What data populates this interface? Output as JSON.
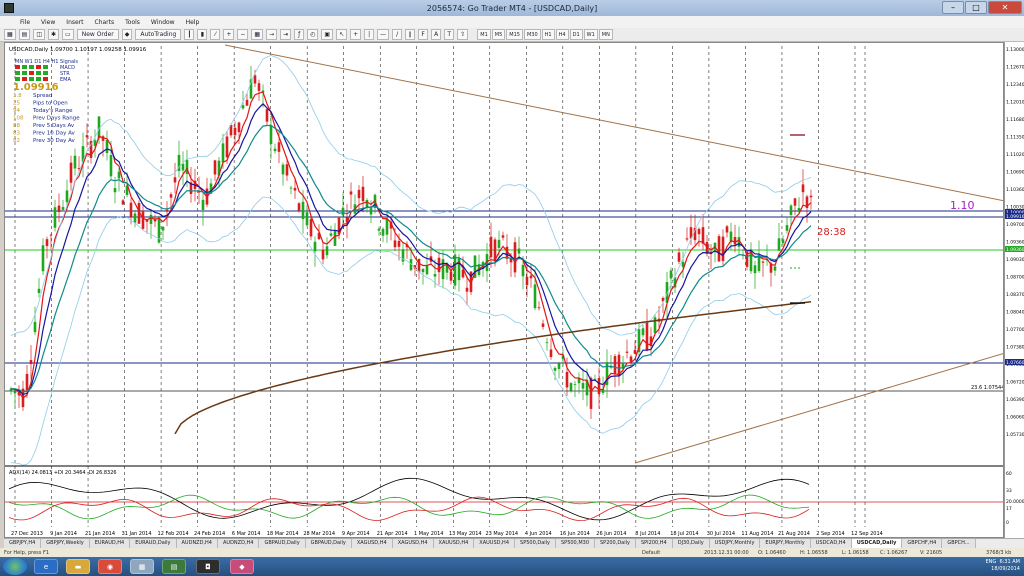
{
  "window": {
    "title": "2056574: Go Trader MT4 - [USDCAD,Daily]"
  },
  "menu": [
    "File",
    "View",
    "Insert",
    "Charts",
    "Tools",
    "Window",
    "Help"
  ],
  "toolbar": {
    "new_order": "New Order",
    "autotrading": "AutoTrading",
    "timeframes": [
      "M1",
      "M5",
      "M15",
      "M30",
      "H1",
      "H4",
      "D1",
      "W1",
      "MN"
    ]
  },
  "chart": {
    "header": "USDCAD,Daily  1.09700 1.10197 1.09258 1.09916",
    "indicator_rows": [
      "MN  W1  D1  H4  H1  Signals",
      "MACD",
      "STR",
      "EMA"
    ],
    "current_price": "1.09916",
    "info_rows": [
      {
        "value": "1.8",
        "label": "Spread"
      },
      {
        "value": "25",
        "label": "Pips to Open"
      },
      {
        "value": "94",
        "label": "Today's Range"
      },
      {
        "value": "108",
        "label": "Prev Days Range"
      },
      {
        "value": "88",
        "label": "Prev 5 Days Av"
      },
      {
        "value": "83",
        "label": "Prev 10 Day Av"
      },
      {
        "value": "82",
        "label": "Prev 30 Day Av"
      }
    ],
    "annotation_level": "1.10",
    "countdown": "28:38",
    "fib_label": "23.6  1.07544",
    "price_ticks": [
      "1.13000",
      "1.12670",
      "1.12340",
      "1.12010",
      "1.11680",
      "1.11350",
      "1.11020",
      "1.10690",
      "1.10360",
      "1.10030",
      "1.09700",
      "1.09360",
      "1.09030",
      "1.08700",
      "1.08370",
      "1.08040",
      "1.07700",
      "1.07380",
      "1.07050",
      "1.06720",
      "1.06390",
      "1.06060",
      "1.05730"
    ],
    "price_tags": [
      {
        "label": "1.10000",
        "color": "#ffffff",
        "bg": "#1a2a8a"
      },
      {
        "label": "1.09916",
        "color": "#ffffff",
        "bg": "#1a2a8a"
      },
      {
        "label": "1.09360",
        "color": "#ffffff",
        "bg": "#22aa22"
      },
      {
        "label": "1.07660",
        "color": "#ffffff",
        "bg": "#1a2a8a"
      }
    ],
    "date_ticks": [
      "27 Dec 2013",
      "9 Jan 2014",
      "21 Jan 2014",
      "31 Jan 2014",
      "12 Feb 2014",
      "24 Feb 2014",
      "6 Mar 2014",
      "18 Mar 2014",
      "28 Mar 2014",
      "9 Apr 2014",
      "21 Apr 2014",
      "1 May 2014",
      "13 May 2014",
      "23 May 2014",
      "4 Jun 2014",
      "16 Jun 2014",
      "26 Jun 2014",
      "8 Jul 2014",
      "18 Jul 2014",
      "30 Jul 2014",
      "11 Aug 2014",
      "21 Aug 2014",
      "2 Sep 2014",
      "12 Sep 2014"
    ],
    "adx_label": "ADX(14) 24.0813  +DI 20.3464  -DI 26.8326",
    "adx_ticks": [
      "60",
      "33",
      "20.0000",
      "17",
      "0"
    ]
  },
  "tabs": [
    "GBPJPY,H4",
    "GBPJPY,Weekly",
    "EURAUD,H4",
    "EURAUD,Daily",
    "AUDNZD,H4",
    "AUDNZD,H4",
    "GBPAUD,Daily",
    "GBPAUD,Daily",
    "XAGUSD,H4",
    "XAGUSD,H4",
    "XAUUSD,H4",
    "XAUUSD,H4",
    "SP500,Daily",
    "SP500,M30",
    "SP200,Daily",
    "SPI200,H4",
    "DJ30,Daily",
    "USDJPY,Monthly",
    "EURJPY,Monthly",
    "USDCAD,H4",
    "USDCAD,Daily",
    "GBPCHF,H4",
    "GBPCH..."
  ],
  "active_tab": "USDCAD,Daily",
  "status": {
    "help": "For Help, press F1",
    "profile": "Default",
    "datetime": "2013.12.31 00:00",
    "o": "O: 1.06460",
    "h": "H: 1.06558",
    "l": "L: 1.06158",
    "c": "C: 1.06267",
    "v": "V: 21605",
    "traffic": "3768/3 kb"
  },
  "tray": {
    "lang": "ENG",
    "time": "6:31 AM",
    "date": "18/09/2014"
  }
}
